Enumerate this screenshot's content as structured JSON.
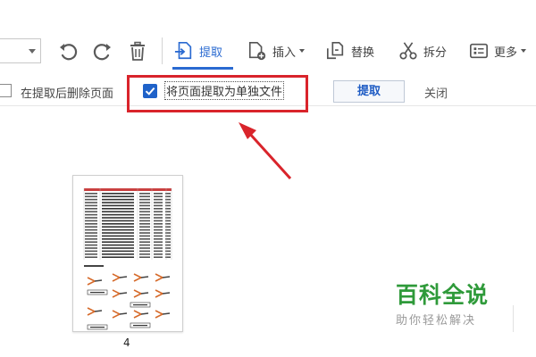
{
  "toolbar": {
    "tools": {
      "extract": "提取",
      "insert": "插入",
      "replace": "替换",
      "split": "拆分",
      "more": "更多"
    },
    "active_tool": "extract",
    "accent_color": "#2a6ad1",
    "icons": [
      "undo-icon",
      "redo-icon",
      "trash-icon",
      "extract-page-icon",
      "insert-page-icon",
      "replace-page-icon",
      "scissors-icon",
      "more-icon"
    ]
  },
  "options": {
    "delete_after_extract_label": "在提取后删除页面",
    "delete_after_extract_checked": false,
    "extract_as_separate_label": "将页面提取为单独文件",
    "extract_as_separate_checked": true,
    "extract_button": "提取",
    "close_link": "关闭"
  },
  "annotation": {
    "highlight_color": "#d9242b"
  },
  "thumbnail": {
    "page_number": "4"
  },
  "watermark": {
    "title": "百科全说",
    "subtitle": "助你轻松解决",
    "color": "#2f9a3a"
  }
}
